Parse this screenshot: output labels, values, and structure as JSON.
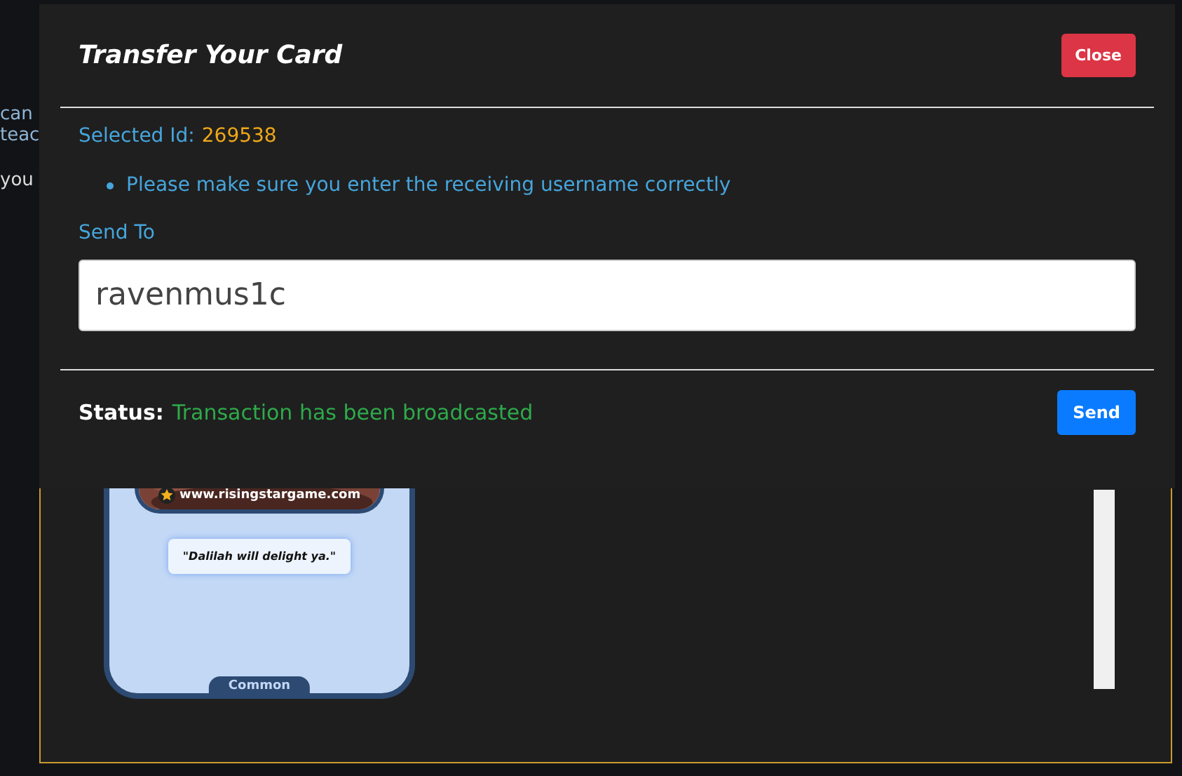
{
  "background": {
    "text_fragments": [
      "can",
      "teac",
      "you"
    ],
    "card": {
      "website": "www.risingstargame.com",
      "quote": "\"Dalilah will delight ya.\"",
      "rarity": "Common"
    }
  },
  "modal": {
    "title": "Transfer Your Card",
    "close_button": "Close",
    "selected_id_label": "Selected Id:",
    "selected_id": "269538",
    "notes": [
      "Please make sure you enter the receiving username correctly"
    ],
    "send_to_label": "Send To",
    "send_to": {
      "value": "ravenmus1c"
    },
    "status_label": "Status:",
    "status": "Transaction has been broadcasted",
    "send_button": "Send"
  }
}
